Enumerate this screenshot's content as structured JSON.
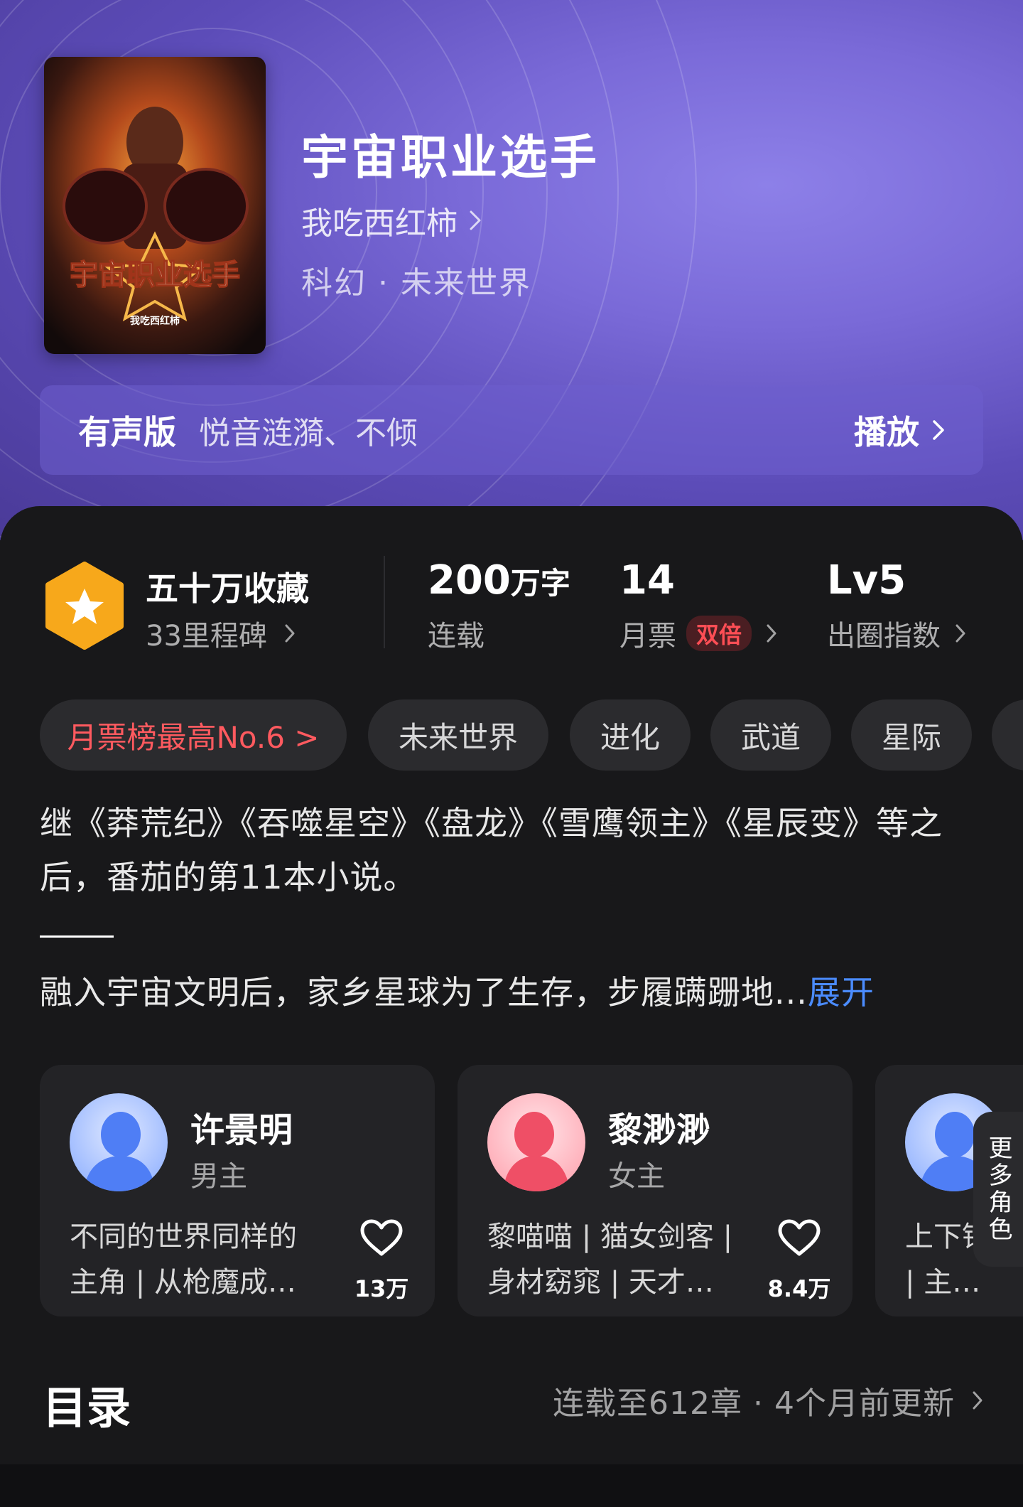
{
  "book": {
    "title": "宇宙职业选手",
    "author": "我吃西红柿",
    "genre": "科幻 · 未来世界",
    "cover_text": "宇宙职业选手",
    "cover_author": "我吃西红柿"
  },
  "audio": {
    "label": "有声版",
    "narrators": "悦音涟漪、不倾",
    "play_label": "播放"
  },
  "stats": {
    "favorites": "五十万收藏",
    "milestones": "33里程碑",
    "word_count": "200",
    "word_unit": "万字",
    "status": "连载",
    "monthly_votes": "14",
    "monthly_votes_label": "月票",
    "double_badge": "双倍",
    "level": "Lv5",
    "level_label": "出圈指数"
  },
  "tags": [
    "月票榜最高No.6 >",
    "未来世界",
    "进化",
    "武道",
    "星际"
  ],
  "description": {
    "intro": "继《莽荒纪》《吞噬星空》《盘龙》《雪鹰领主》《星辰变》等之后，番茄的第11本小说。",
    "synopsis": "融入宇宙文明后，家乡星球为了生存，步履蹒跚地...",
    "expand_label": "展开"
  },
  "characters": [
    {
      "name": "许景明",
      "role": "男主",
      "desc": "不同的世界同样的主角 | 从枪魔成…",
      "likes": "13万"
    },
    {
      "name": "黎渺渺",
      "role": "女主",
      "desc": "黎喵喵 | 猫女剑客 | 身材窈窕 | 天才…",
      "likes": "8.4万"
    },
    {
      "name": "",
      "role": "",
      "desc": "上下铺兄弟 | 教练 | 主…",
      "likes": ""
    }
  ],
  "more_roles_label": "更多角色",
  "toc": {
    "title": "目录",
    "info": "连载至612章 · 4个月前更新"
  },
  "colors": {
    "accent_blue": "#4b8cff",
    "rank_red": "#ff5a5f",
    "badge_gold": "#f7a81b",
    "hero_purple": "#7a6ad8"
  }
}
